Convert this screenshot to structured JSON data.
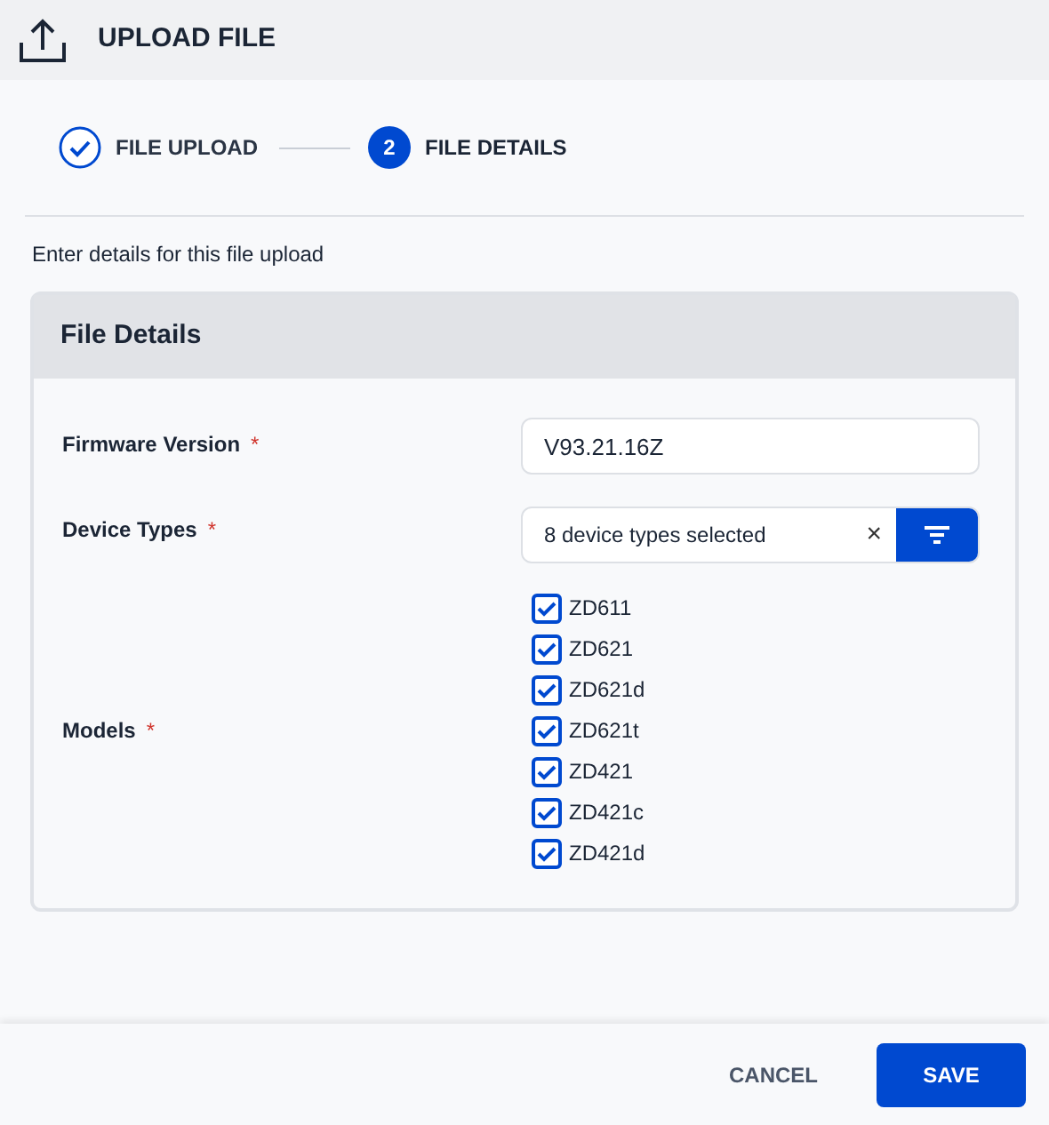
{
  "header": {
    "title": "UPLOAD FILE"
  },
  "steps": [
    {
      "label": "FILE UPLOAD",
      "completed": true,
      "selected": false
    },
    {
      "label": "FILE DETAILS",
      "number": "2",
      "completed": false,
      "selected": true
    }
  ],
  "instructions": "Enter details for this file upload",
  "card": {
    "title": "File Details",
    "firmware": {
      "label": "Firmware Version",
      "required_mark": "*",
      "value": "V93.21.16Z"
    },
    "device_types": {
      "label": "Device Types",
      "required_mark": "*",
      "value": "8 device types selected",
      "clear": "×"
    },
    "models": {
      "label": "Models",
      "required_mark": "*",
      "items": [
        {
          "label": "ZD611",
          "checked": true
        },
        {
          "label": "ZD621",
          "checked": true
        },
        {
          "label": "ZD621d",
          "checked": true
        },
        {
          "label": "ZD621t",
          "checked": true
        },
        {
          "label": "ZD421",
          "checked": true
        },
        {
          "label": "ZD421c",
          "checked": true
        },
        {
          "label": "ZD421d",
          "checked": true
        }
      ]
    }
  },
  "footer": {
    "cancel": "CANCEL",
    "save": "SAVE"
  }
}
